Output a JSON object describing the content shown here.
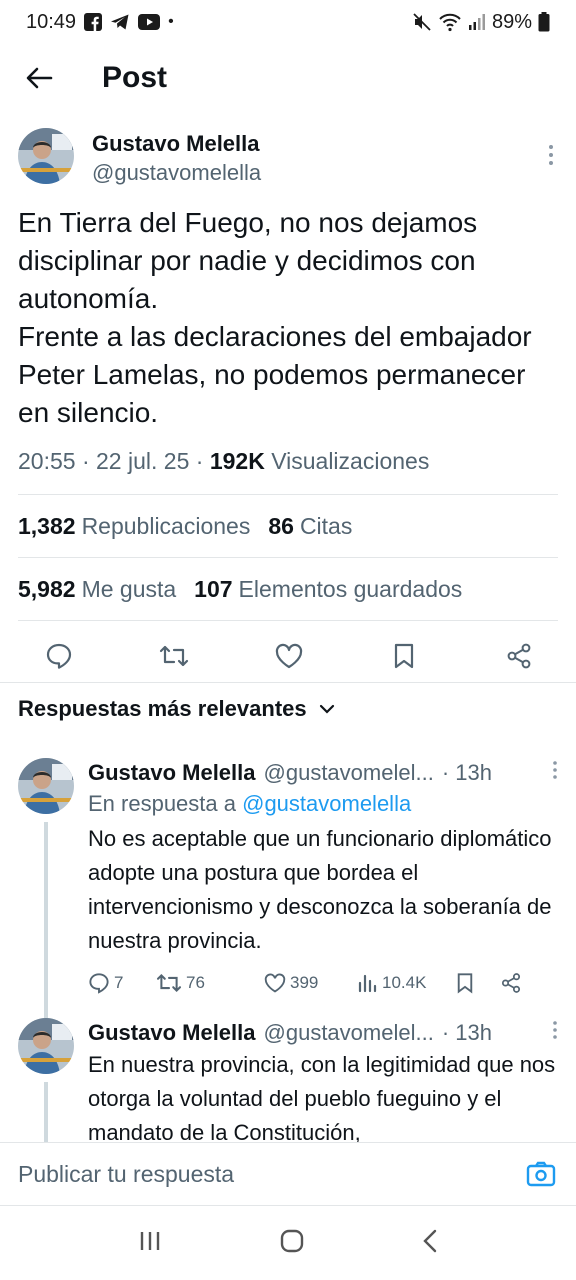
{
  "status_bar": {
    "time": "10:49",
    "dot": "•",
    "battery": "89%",
    "app_icons": [
      "facebook-icon",
      "telegram-icon",
      "youtube-icon"
    ]
  },
  "header": {
    "title": "Post"
  },
  "post": {
    "author_name": "Gustavo Melella",
    "author_handle": "@gustavomelella",
    "text_line1": "En Tierra del Fuego, no nos dejamos disciplinar por nadie y decidimos con autonomía.",
    "text_line2": "Frente a las declaraciones del embajador Peter Lamelas, no podemos permanecer en silencio.",
    "time": "20:55",
    "date": "22 jul. 25",
    "separator": "·",
    "views_count": "192K",
    "views_label": "Visualizaciones",
    "reposts_count": "1,382",
    "reposts_label": "Republicaciones",
    "quotes_count": "86",
    "quotes_label": "Citas",
    "likes_count": "5,982",
    "likes_label": "Me gusta",
    "bookmarks_count": "107",
    "bookmarks_label": "Elementos guardados"
  },
  "replies_sort": {
    "label": "Respuestas más relevantes"
  },
  "replies": [
    {
      "author_name": "Gustavo Melella",
      "author_handle": "@gustavomelel...",
      "time": "· 13h",
      "in_reply_prefix": "En respuesta a",
      "in_reply_mention": "@gustavomelella",
      "text": "No es aceptable que un funcionario diplomático adopte una postura que bordea el intervencionismo y desconozca la soberanía de nuestra provincia.",
      "replies_count": "7",
      "reposts_count": "76",
      "likes_count": "399",
      "views_count": "10.4K"
    },
    {
      "author_name": "Gustavo Melella",
      "author_handle": "@gustavomelel...",
      "time": "· 13h",
      "text": "En nuestra provincia, con la legitimidad que nos otorga la voluntad del pueblo fueguino y el mandato de la Constitución,"
    }
  ],
  "compose": {
    "placeholder": "Publicar tu respuesta"
  },
  "colors": {
    "accent": "#1d9bf0",
    "text": "#0f1419",
    "secondary": "#536471",
    "divider": "#e3e6e8"
  }
}
